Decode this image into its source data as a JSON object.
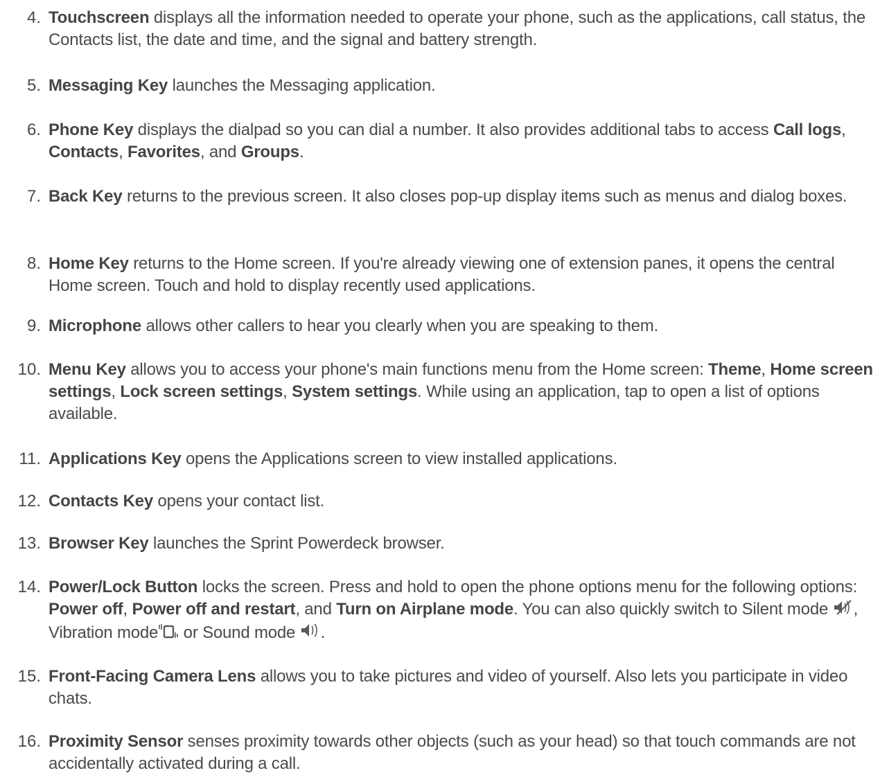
{
  "items": [
    {
      "num": "4.",
      "runs": [
        {
          "b": true,
          "t": "Touchscreen"
        },
        {
          "t": " displays all the information needed to operate your phone, such as the applications, call status, the Contacts list, the date and time, and the signal and battery strength."
        }
      ]
    },
    {
      "num": "5.",
      "runs": [
        {
          "b": true,
          "t": "Messaging Key"
        },
        {
          "t": " launches the Messaging application."
        }
      ]
    },
    {
      "num": "6.",
      "runs": [
        {
          "b": true,
          "t": "Phone Key"
        },
        {
          "t": " displays the dialpad so you can dial a number. It also provides additional tabs to access "
        },
        {
          "b": true,
          "t": "Call logs"
        },
        {
          "t": ", "
        },
        {
          "b": true,
          "t": "Contacts"
        },
        {
          "t": ", "
        },
        {
          "b": true,
          "t": "Favorites"
        },
        {
          "t": ", and "
        },
        {
          "b": true,
          "t": "Groups"
        },
        {
          "t": "."
        }
      ]
    },
    {
      "num": "7.",
      "runs": [
        {
          "b": true,
          "t": "Back Key"
        },
        {
          "t": " returns to the previous screen. It also closes pop-up display items such as menus and dialog boxes."
        }
      ]
    },
    {
      "num": "8.",
      "runs": [
        {
          "b": true,
          "t": "Home Key"
        },
        {
          "t": " returns to the Home screen. If you're already viewing one of extension panes, it opens the central Home screen. Touch and hold to display recently used applications."
        }
      ]
    },
    {
      "num": "9.",
      "runs": [
        {
          "b": true,
          "t": "Microphone"
        },
        {
          "t": " allows other callers to hear you clearly when you are speaking to them."
        }
      ]
    },
    {
      "num": "10.",
      "runs": [
        {
          "b": true,
          "t": "Menu Key"
        },
        {
          "t": " allows you to access your phone's main functions menu from the Home screen: "
        },
        {
          "b": true,
          "t": "Theme"
        },
        {
          "t": ", "
        },
        {
          "b": true,
          "t": "Home screen settings"
        },
        {
          "t": ", "
        },
        {
          "b": true,
          "t": "Lock screen settings"
        },
        {
          "t": ", "
        },
        {
          "b": true,
          "t": "System settings"
        },
        {
          "t": ". While using an application, tap to open a list of options available."
        }
      ]
    },
    {
      "num": "11.",
      "runs": [
        {
          "b": true,
          "t": "Applications Key"
        },
        {
          "t": " opens the Applications screen to view installed applications."
        }
      ]
    },
    {
      "num": "12.",
      "runs": [
        {
          "b": true,
          "t": "Contacts Key"
        },
        {
          "t": " opens your contact list."
        }
      ]
    },
    {
      "num": "13.",
      "runs": [
        {
          "b": true,
          "t": "Browser Key"
        },
        {
          "t": " launches the Sprint Powerdeck browser."
        }
      ]
    },
    {
      "num": "14.",
      "runs": [
        {
          "b": true,
          "t": "Power/Lock Button"
        },
        {
          "t": " locks the screen. Press and hold to open the phone options menu for the following options: "
        },
        {
          "b": true,
          "t": "Power off"
        },
        {
          "t": ", "
        },
        {
          "b": true,
          "t": "Power off and restart"
        },
        {
          "t": ", and "
        },
        {
          "b": true,
          "t": "Turn on Airplane mode"
        },
        {
          "t": ". You can also quickly switch to Silent mode "
        },
        {
          "icon": "silent-mode-icon"
        },
        {
          "t": ", Vibration mode"
        },
        {
          "icon": "vibration-mode-icon"
        },
        {
          "t": " or Sound mode "
        },
        {
          "icon": "sound-mode-icon"
        },
        {
          "t": "."
        }
      ]
    },
    {
      "num": "15.",
      "runs": [
        {
          "b": true,
          "t": "Front-Facing Camera Lens"
        },
        {
          "t": " allows you to take pictures and video of yourself. Also lets you participate in video chats."
        }
      ]
    },
    {
      "num": "16.",
      "runs": [
        {
          "b": true,
          "t": "Proximity Sensor"
        },
        {
          "t": " senses proximity towards other objects (such as your head) so that touch commands are not accidentally activated during a call."
        }
      ]
    }
  ]
}
